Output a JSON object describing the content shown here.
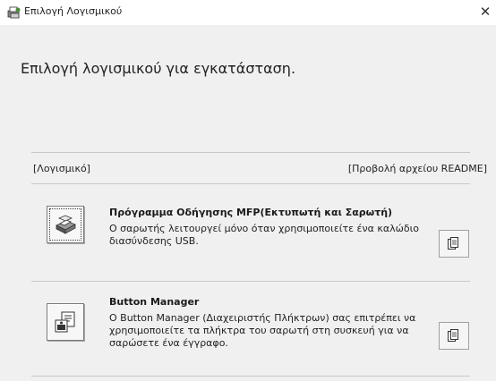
{
  "window": {
    "title": "Επιλογή Λογισμικού",
    "close_symbol": "✕",
    "app_icon": "installer-icon"
  },
  "main": {
    "heading": "Επιλογή λογισμικού για εγκατάσταση.",
    "column_left": "[Λογισμικό]",
    "column_right": "[Προβολή αρχείου README]"
  },
  "software": [
    {
      "title": "Πρόγραμμα Οδήγησης MFP(Εκτυπωτή και Σαρωτή)",
      "description": "Ο σαρωτής λειτουργεί μόνο όταν χρησιμοποιείτε ένα καλώδιο διασύνδεσης USB.",
      "icon": "printer-scanner-icon",
      "readme_icon": "document-icon"
    },
    {
      "title": "Button Manager",
      "description": "Ο Button Manager (Διαχειριστής Πλήκτρων) σας επιτρέπει να χρησιμοποιείτε τα πλήκτρα του σαρωτή στη συσκευή για να σαρώσετε ένα έγγραφο.",
      "icon": "button-manager-icon",
      "readme_icon": "document-icon"
    }
  ]
}
